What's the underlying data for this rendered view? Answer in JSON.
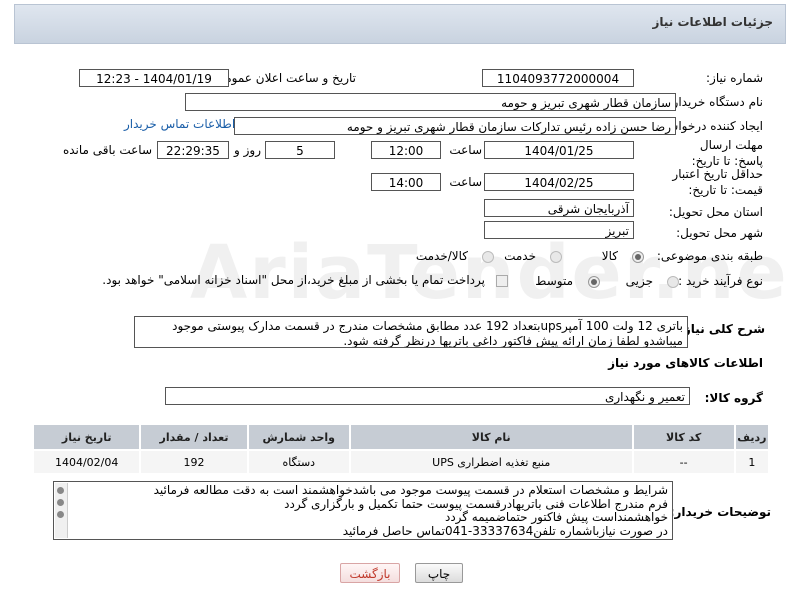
{
  "header": {
    "title": "جزئیات اطلاعات نیاز"
  },
  "fields": {
    "need_number_label": "شماره نیاز:",
    "need_number": "1104093772000004",
    "announce_label": "تاریخ و ساعت اعلان عمومی:",
    "announce_value": "1404/01/19 - 12:23",
    "buyer_org_label": "نام دستگاه خریدار:",
    "buyer_org": "سازمان قطار شهری تبریز و حومه",
    "creator_label": "ایجاد کننده درخواست:",
    "creator": "رضا حسن زاده رئیس تدارکات سازمان قطار شهری تبریز و حومه",
    "contact_link": "اطلاعات تماس خریدار",
    "deadline_label": "مهلت ارسال پاسخ: تا تاریخ:",
    "deadline_date": "1404/01/25",
    "time_label": "ساعت",
    "deadline_time": "12:00",
    "days_value": "5",
    "days_label": "روز و",
    "remaining_time": "22:29:35",
    "remaining_label": "ساعت باقی مانده",
    "validity_label": "حداقل تاریخ اعتبار قیمت: تا تاریخ:",
    "validity_date": "1404/02/25",
    "validity_time": "14:00",
    "province_label": "استان محل تحویل:",
    "province": "آذربایجان شرقی",
    "city_label": "شهر محل تحویل:",
    "city": "تبریز",
    "category_label": "طبقه بندی موضوعی:",
    "category_options": [
      "کالا",
      "خدمت",
      "کالا/خدمت"
    ],
    "process_label": "نوع فرآیند خرید :",
    "process_options": [
      "جزیی",
      "متوسط"
    ],
    "payment_note": "پرداخت تمام یا بخشی از مبلغ خرید،از محل \"اسناد خزانه اسلامی\" خواهد بود."
  },
  "description": {
    "label": "شرح کلی نیاز:",
    "text": "باتری 12 ولت 100 آمپرupsبتعداد 192 عدد مطابق مشخصات مندرج در قسمت مدارک پیوستی موجود میباشدو لطفا زمان ارائه پیش فاکتور داغی باتریها درنظر گرفته شود."
  },
  "goods": {
    "section_title": "اطلاعات کالاهای مورد نیاز",
    "group_label": "گروه کالا:",
    "group_value": "تعمیر و نگهداری",
    "columns": [
      "ردیف",
      "کد کالا",
      "نام کالا",
      "واحد شمارش",
      "تعداد / مقدار",
      "تاریخ نیاز"
    ],
    "rows": [
      [
        "1",
        "--",
        "منبع تغذیه اضطراری UPS",
        "دستگاه",
        "192",
        "1404/02/04"
      ]
    ]
  },
  "buyer_notes": {
    "label": "توضیحات خریدار:",
    "lines": [
      "شرایط و مشخصات استعلام در قسمت پیوست موجود می باشدخواهشمند است به دقت مطالعه فرمائید",
      "فرم مندرج اطلاعات فنی باتریهادرقسمت پیوست حتما تکمیل و بارگزاری گردد",
      "خواهشمنداست پیش فاکتور حتماضمیمه گردد",
      "در صورت نیازباشماره تلفن33337634-041تماس حاصل فرمائید"
    ]
  },
  "buttons": {
    "print": "چاپ",
    "back": "بازگشت"
  },
  "watermark": "AriaTender.neT"
}
